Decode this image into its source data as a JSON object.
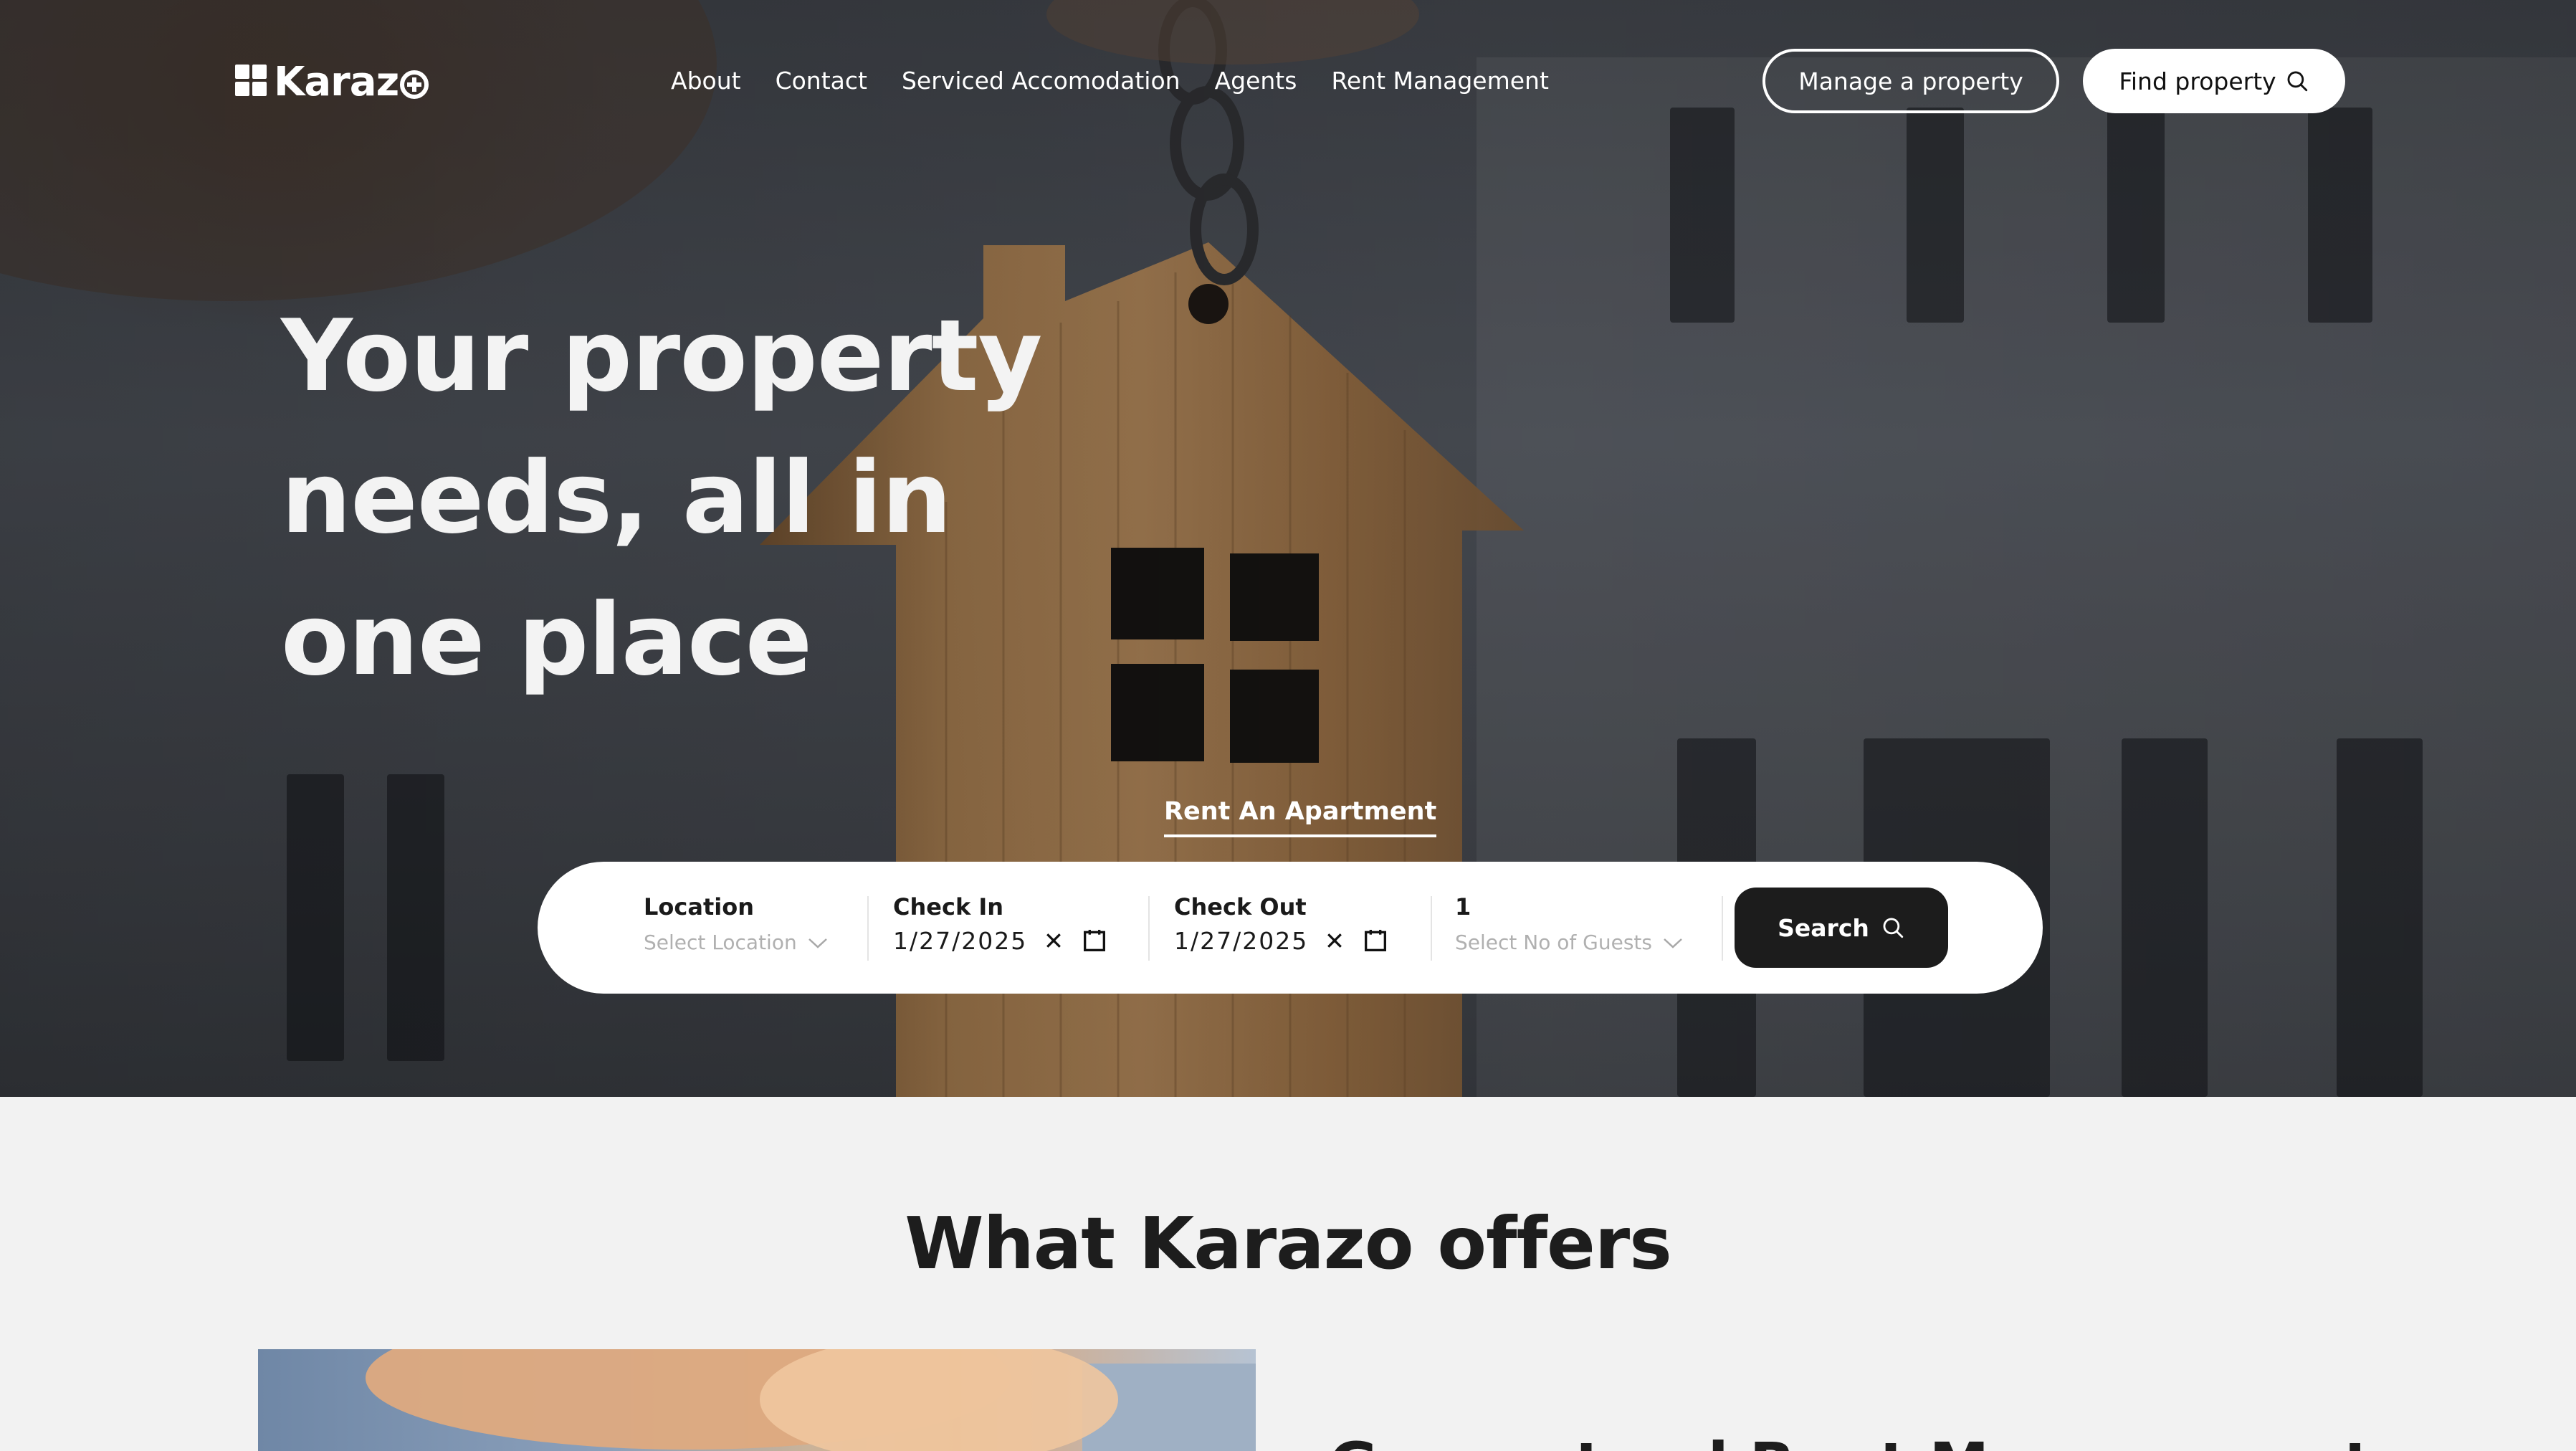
{
  "brand": {
    "name": "Karaz"
  },
  "nav": {
    "links": [
      "About",
      "Contact",
      "Serviced Accomodation",
      "Agents",
      "Rent Management"
    ]
  },
  "header": {
    "manage_label": "Manage a property",
    "find_label": "Find property"
  },
  "hero": {
    "title_lines": [
      "Your property",
      "needs, all in",
      "one place"
    ],
    "tab_label": "Rent An Apartment"
  },
  "search": {
    "location": {
      "label": "Location",
      "placeholder": "Select Location"
    },
    "check_in": {
      "label": "Check In",
      "month": "1",
      "day": "27",
      "year": "2025"
    },
    "check_out": {
      "label": "Check Out",
      "month": "1",
      "day": "27",
      "year": "2025"
    },
    "guests": {
      "label": "1",
      "placeholder": "Select No of Guests"
    },
    "button_label": "Search"
  },
  "offers": {
    "title": "What Karazo offers",
    "first_heading": "Guaranteed Rent Management"
  },
  "colors": {
    "hero_overlay": "#3f4248",
    "search_button": "#1c1c1c",
    "page_bg": "#f2f2f2",
    "text_dark": "#1d1d1d"
  },
  "icons": {
    "search": "search-icon",
    "chevron": "chevron-down-icon",
    "clear": "close-icon",
    "calendar": "calendar-icon"
  }
}
